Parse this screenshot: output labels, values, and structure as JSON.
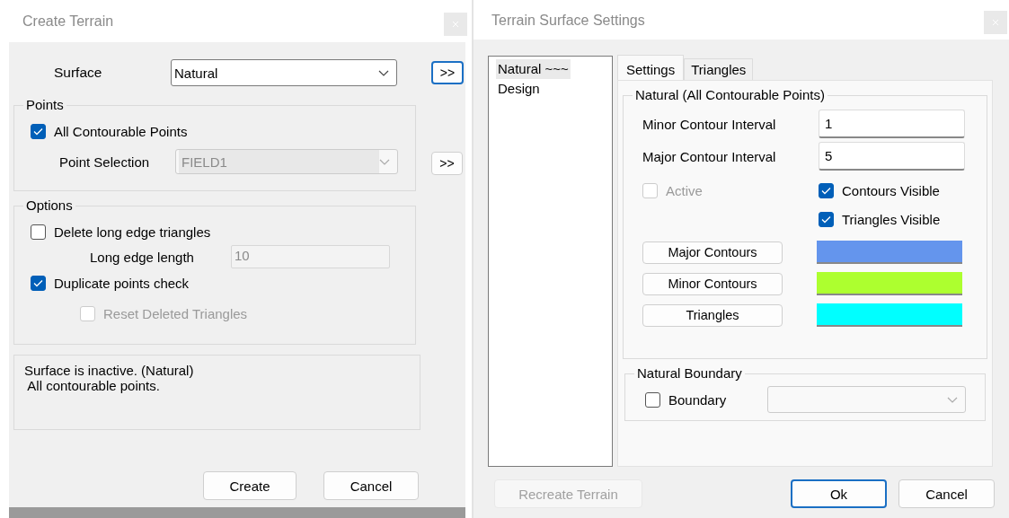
{
  "create_terrain": {
    "title": "Create Terrain",
    "surface_label": "Surface",
    "surface_value": "Natural",
    "surface_more": ">>",
    "points": {
      "title": "Points",
      "all_points": {
        "label": "All Contourable Points",
        "checked": true,
        "disabled": false
      },
      "selection_label": "Point Selection",
      "selection_value": "FIELD1",
      "selection_disabled": true,
      "more": ">>"
    },
    "options": {
      "title": "Options",
      "delete_long": {
        "label": "Delete long edge triangles",
        "checked": false,
        "disabled": false
      },
      "length_label": "Long edge length",
      "length_value": "10",
      "length_disabled": true,
      "duplicate": {
        "label": "Duplicate points check",
        "checked": true,
        "disabled": false
      },
      "reset_deleted": {
        "label": "Reset Deleted Triangles",
        "checked": false,
        "disabled": true
      }
    },
    "status_lines": [
      "Surface is inactive. (Natural)",
      " All contourable points."
    ],
    "buttons": [
      {
        "label": "Create",
        "default": false,
        "disabled": false
      },
      {
        "label": "Cancel",
        "default": false,
        "disabled": false
      }
    ]
  },
  "surface_settings": {
    "title": "Terrain Surface Settings",
    "surfaces": [
      {
        "label": "Natural ~~~",
        "selected": true
      },
      {
        "label": "Design",
        "selected": false
      }
    ],
    "tabs": [
      {
        "label": "Settings",
        "selected": true
      },
      {
        "label": "Triangles",
        "selected": false
      }
    ],
    "group_title": "Natural (All Contourable Points)",
    "fields": [
      {
        "label": "Minor Contour Interval",
        "value": "1"
      },
      {
        "label": "Major Contour Interval",
        "value": "5"
      }
    ],
    "active": {
      "label": "Active",
      "checked": false,
      "disabled": true
    },
    "visibility": [
      {
        "label": "Contours Visible",
        "checked": true,
        "disabled": false
      },
      {
        "label": "Triangles Visible",
        "checked": true,
        "disabled": false
      }
    ],
    "colors": [
      {
        "label": "Major Contours",
        "color": "#6495ed"
      },
      {
        "label": "Minor Contours",
        "color": "#adff2f"
      },
      {
        "label": "Triangles",
        "color": "#00ffff"
      }
    ],
    "boundary": {
      "title": "Natural Boundary",
      "checkbox": {
        "label": "Boundary",
        "checked": false,
        "disabled": false
      },
      "dropdown_disabled": true
    },
    "buttons": [
      {
        "label": "Recreate Terrain",
        "default": false,
        "disabled": true
      },
      {
        "label": "Ok",
        "default": true,
        "disabled": false
      },
      {
        "label": "Cancel",
        "default": false,
        "disabled": false
      }
    ]
  }
}
